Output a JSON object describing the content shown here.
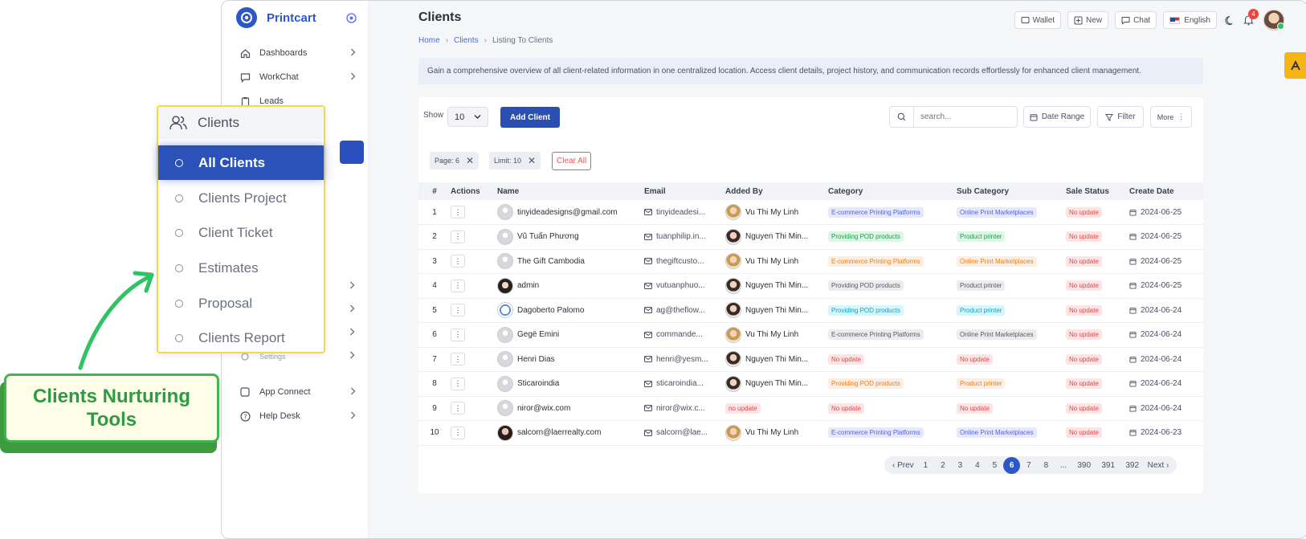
{
  "brand": {
    "name": "Printcart"
  },
  "sidebar": {
    "items": [
      {
        "label": "Dashboards",
        "icon": "home-icon"
      },
      {
        "label": "WorkChat",
        "icon": "chat-icon"
      },
      {
        "label": "Leads",
        "icon": "clipboard-icon"
      }
    ],
    "bottom_items": [
      {
        "label": "App Connect",
        "icon": "square-icon"
      },
      {
        "label": "Help Desk",
        "icon": "help-icon"
      }
    ],
    "partial_item": "Settings"
  },
  "header": {
    "title": "Clients",
    "breadcrumb": [
      "Home",
      "Clients",
      "Listing To Clients"
    ],
    "actions": {
      "wallet": "Wallet",
      "new": "New",
      "chat": "Chat",
      "language": "English"
    },
    "notification_count": "4"
  },
  "info": "Gain a comprehensive overview of all client-related information in one centralized location. Access client details, project history, and communication records effortlessly for enhanced client management.",
  "toolbar": {
    "show_label": "Show",
    "limit_value": "10",
    "add_client": "Add Client",
    "search_placeholder": "search...",
    "date_range": "Date Range",
    "filter": "Filter",
    "more": "More"
  },
  "filters": {
    "page_chip": "Page: 6",
    "limit_chip": "Limit: 10",
    "clear_all": "Clear All"
  },
  "table": {
    "columns": [
      "#",
      "Actions",
      "Name",
      "Email",
      "Added By",
      "Category",
      "Sub Category",
      "Sale Status",
      "Create Date"
    ],
    "rows": [
      {
        "num": "1",
        "name": "tinyideadesigns@gmail.com",
        "email": "tinyideadesi...",
        "added_by": "Vu Thi My Linh",
        "category": "E-commerce Printing Platforms",
        "subcategory": "Online Print Marketplaces",
        "status": "No update",
        "date": "2024-06-25"
      },
      {
        "num": "2",
        "name": "Vũ Tuấn Phương",
        "email": "tuanphilip.in...",
        "added_by": "Nguyen Thi Min...",
        "category": "Providing POD products",
        "subcategory": "Product printer",
        "status": "No update",
        "date": "2024-06-25"
      },
      {
        "num": "3",
        "name": "The Gift Cambodia",
        "email": "thegiftcusto...",
        "added_by": "Vu Thi My Linh",
        "category": "E-commerce Printing Platforms",
        "subcategory": "Online Print Marketplaces",
        "status": "No update",
        "date": "2024-06-25"
      },
      {
        "num": "4",
        "name": "admin",
        "email": "vutuanphuo...",
        "added_by": "Nguyen Thi Min...",
        "category": "Providing POD products",
        "subcategory": "Product printer",
        "status": "No update",
        "date": "2024-06-25"
      },
      {
        "num": "5",
        "name": "Dagoberto Palomo",
        "email": "ag@theflow...",
        "added_by": "Nguyen Thi Min...",
        "category": "Providing POD products",
        "subcategory": "Product printer",
        "status": "No update",
        "date": "2024-06-24"
      },
      {
        "num": "6",
        "name": "Gegë Emini",
        "email": "commande...",
        "added_by": "Vu Thi My Linh",
        "category": "E-commerce Printing Platforms",
        "subcategory": "Online Print Marketplaces",
        "status": "No update",
        "date": "2024-06-24"
      },
      {
        "num": "7",
        "name": "Henri Dias",
        "email": "henri@yesm...",
        "added_by": "Nguyen Thi Min...",
        "category": "No update",
        "subcategory": "No update",
        "status": "No update",
        "date": "2024-06-24"
      },
      {
        "num": "8",
        "name": "Sticaroindia",
        "email": "sticaroindia...",
        "added_by": "Nguyen Thi Min...",
        "category": "Providing POD products",
        "subcategory": "Product printer",
        "status": "No update",
        "date": "2024-06-24"
      },
      {
        "num": "9",
        "name": "niror@wix.com",
        "email": "niror@wix.c...",
        "added_by": "no update",
        "category": "No update",
        "subcategory": "No update",
        "status": "No update",
        "date": "2024-06-24"
      },
      {
        "num": "10",
        "name": "salcorn@laerrealty.com",
        "email": "salcorn@lae...",
        "added_by": "Vu Thi My Linh",
        "category": "E-commerce Printing Platforms",
        "subcategory": "Online Print Marketplaces",
        "status": "No update",
        "date": "2024-06-23"
      }
    ]
  },
  "pagination": {
    "prev": "‹ Prev",
    "pages": [
      "1",
      "2",
      "3",
      "4",
      "5",
      "6",
      "7",
      "8",
      "...",
      "390",
      "391",
      "392"
    ],
    "current": "6",
    "next": "Next ›"
  },
  "dropdown": {
    "header": "Clients",
    "items": [
      "All Clients",
      "Clients Project",
      "Client Ticket",
      "Estimates",
      "Proposal",
      "Clients Report"
    ],
    "active": "All Clients"
  },
  "callout": {
    "text": "Clients Nurturing Tools"
  },
  "colors": {
    "accent": "#2d57c9",
    "highlight": "#f1d94a",
    "callout_green": "#3fb54a"
  }
}
